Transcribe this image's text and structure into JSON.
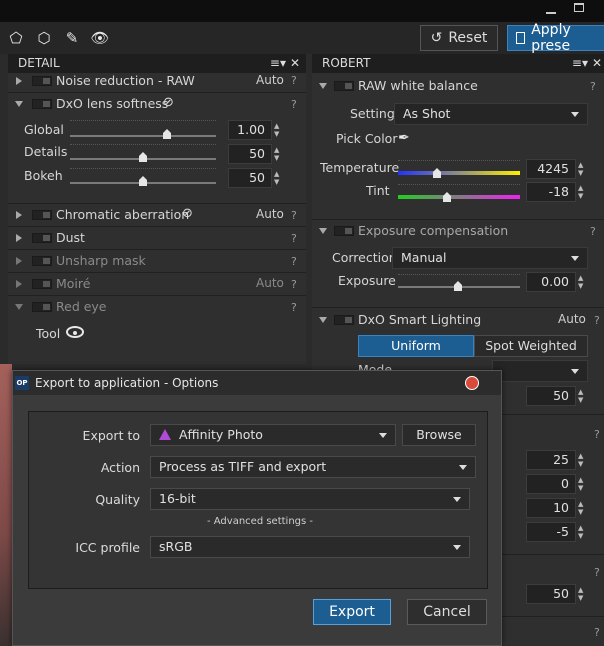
{
  "toolbar": {
    "reset_label": "Reset",
    "apply_label": "Apply prese"
  },
  "detail_panel": {
    "title": "DETAIL",
    "items": [
      {
        "label": "Noise reduction - RAW",
        "badge": "Auto"
      },
      {
        "label": "DxO lens softness"
      },
      {
        "label": "Chromatic aberration",
        "badge": "Auto"
      },
      {
        "label": "Dust"
      },
      {
        "label": "Unsharp mask"
      },
      {
        "label": "Moiré",
        "badge": "Auto"
      },
      {
        "label": "Red eye"
      }
    ],
    "lens_sliders": [
      {
        "label": "Global",
        "value": "1.00",
        "fraction": 0.65
      },
      {
        "label": "Details",
        "value": "50",
        "fraction": 0.5
      },
      {
        "label": "Bokeh",
        "value": "50",
        "fraction": 0.5
      }
    ],
    "tool_label": "Tool"
  },
  "robert_panel": {
    "title": "ROBERT",
    "wb": {
      "title": "RAW white balance",
      "setting_label": "Setting",
      "setting_value": "As Shot",
      "pick_color_label": "Pick Color",
      "temperature_label": "Temperature",
      "temperature_value": "4245 K",
      "tint_label": "Tint",
      "tint_value": "-18"
    },
    "exposure": {
      "title": "Exposure compensation",
      "correction_label": "Correction",
      "correction_value": "Manual",
      "exposure_label": "Exposure",
      "exposure_value": "0.00"
    },
    "smart_lighting": {
      "title": "DxO Smart Lighting",
      "badge": "Auto",
      "uniform_label": "Uniform",
      "spot_label": "Spot Weighted",
      "mode_label": "Mode",
      "value": "50"
    },
    "hidden_values": [
      "25",
      "0",
      "10",
      "-5",
      "50"
    ]
  },
  "dialog": {
    "icon_text": "OP",
    "title": "Export to application - Options",
    "export_to_label": "Export to",
    "export_to_value": "Affinity Photo",
    "browse_label": "Browse",
    "action_label": "Action",
    "action_value": "Process as TIFF and export",
    "quality_label": "Quality",
    "quality_value": "16-bit",
    "advanced_label": "- Advanced settings -",
    "icc_label": "ICC profile",
    "icc_value": "sRGB",
    "export_button": "Export",
    "cancel_button": "Cancel"
  },
  "colors": {
    "accent_blue": "#1d5e92",
    "panel_bg": "#2f2f2f"
  }
}
